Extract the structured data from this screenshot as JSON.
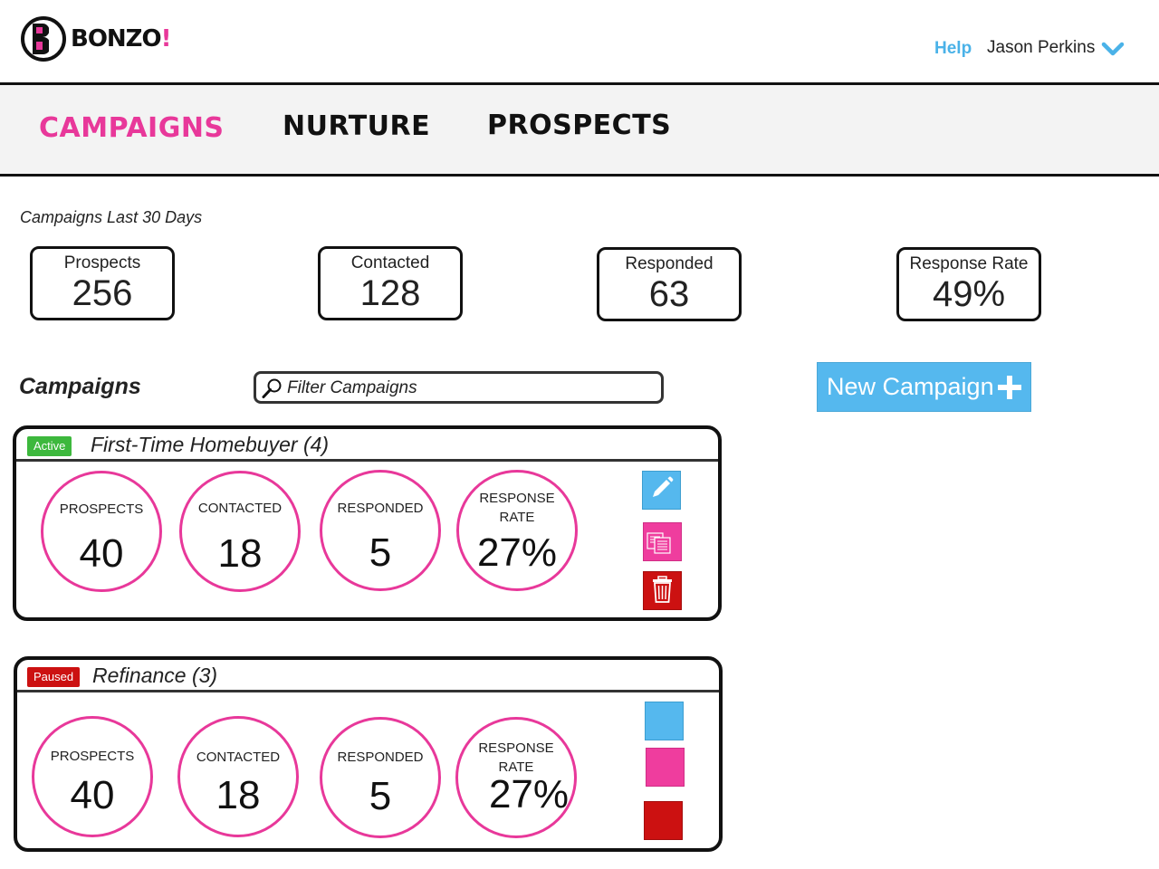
{
  "brand": {
    "name": "BONZO",
    "bang": "!"
  },
  "header": {
    "help_label": "Help",
    "user_name": "Jason Perkins"
  },
  "nav": {
    "tabs": [
      "CAMPAIGNS",
      "NURTURE",
      "PROSPECTS"
    ],
    "active": "CAMPAIGNS"
  },
  "summary": {
    "label": "Campaigns Last 30 Days",
    "stats": [
      {
        "label": "Prospects",
        "value": "256"
      },
      {
        "label": "Contacted",
        "value": "128"
      },
      {
        "label": "Responded",
        "value": "63"
      },
      {
        "label": "Response Rate",
        "value": "49%"
      }
    ]
  },
  "campaigns_section": {
    "title": "Campaigns",
    "filter_placeholder": "Filter Campaigns",
    "new_button_label": "New Campaign"
  },
  "campaigns": [
    {
      "status": "Active",
      "status_color": "#3db83d",
      "name": "First-Time Homebuyer (4)",
      "metrics": [
        {
          "label_lines": [
            "PROSPECTS"
          ],
          "value": "40"
        },
        {
          "label_lines": [
            "CONTACTED"
          ],
          "value": "18"
        },
        {
          "label_lines": [
            "RESPONDED"
          ],
          "value": "5"
        },
        {
          "label_lines": [
            "RESPONSE",
            "RATE"
          ],
          "value": "27%"
        }
      ]
    },
    {
      "status": "Paused",
      "status_color": "#cc1111",
      "name": "Refinance (3)",
      "metrics": [
        {
          "label_lines": [
            "PROSPECTS"
          ],
          "value": "40"
        },
        {
          "label_lines": [
            "CONTACTED"
          ],
          "value": "18"
        },
        {
          "label_lines": [
            "RESPONDED"
          ],
          "value": "5"
        },
        {
          "label_lines": [
            "RESPONSE",
            "RATE"
          ],
          "value": "27%"
        }
      ]
    }
  ],
  "colors": {
    "accent_pink": "#e8389a",
    "accent_blue": "#55b8ee",
    "danger_red": "#cc1111"
  }
}
